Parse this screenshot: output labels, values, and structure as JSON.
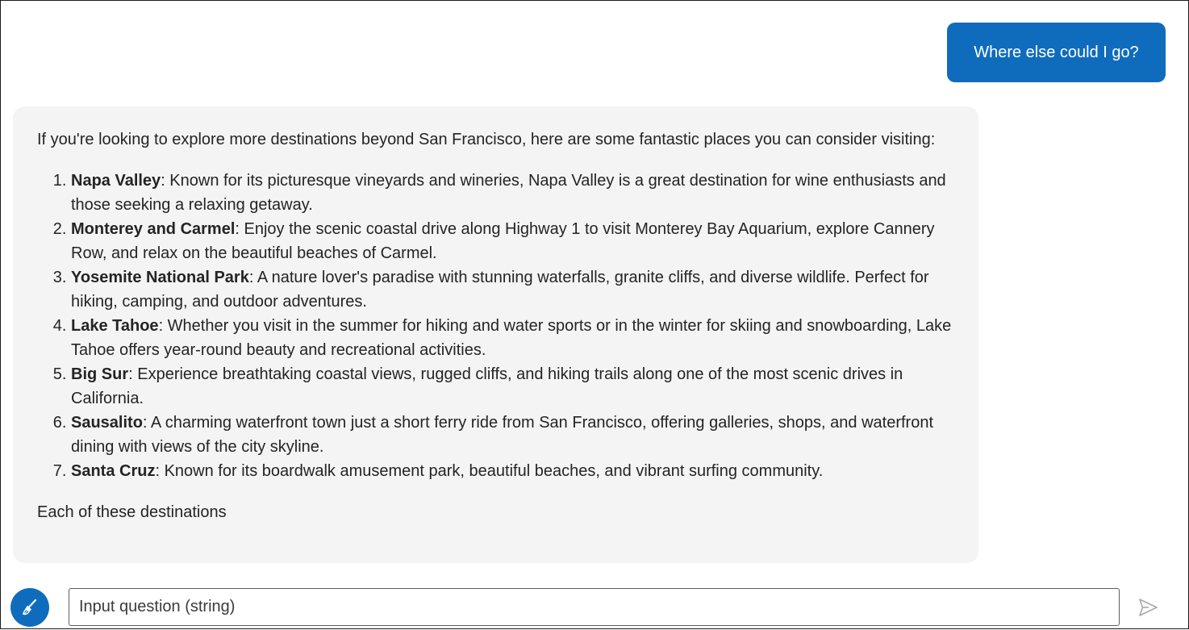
{
  "user_message": "Where else could I go?",
  "assistant": {
    "intro": "If you're looking to explore more destinations beyond San Francisco, here are some fantastic places you can consider visiting:",
    "items": [
      {
        "title": "Napa Valley",
        "text": ": Known for its picturesque vineyards and wineries, Napa Valley is a great destination for wine enthusiasts and those seeking a relaxing getaway."
      },
      {
        "title": "Monterey and Carmel",
        "text": ": Enjoy the scenic coastal drive along Highway 1 to visit Monterey Bay Aquarium, explore Cannery Row, and relax on the beautiful beaches of Carmel."
      },
      {
        "title": "Yosemite National Park",
        "text": ": A nature lover's paradise with stunning waterfalls, granite cliffs, and diverse wildlife. Perfect for hiking, camping, and outdoor adventures."
      },
      {
        "title": "Lake Tahoe",
        "text": ": Whether you visit in the summer for hiking and water sports or in the winter for skiing and snowboarding, Lake Tahoe offers year-round beauty and recreational activities."
      },
      {
        "title": "Big Sur",
        "text": ": Experience breathtaking coastal views, rugged cliffs, and hiking trails along one of the most scenic drives in California."
      },
      {
        "title": "Sausalito",
        "text": ": A charming waterfront town just a short ferry ride from San Francisco, offering galleries, shops, and waterfront dining with views of the city skyline."
      },
      {
        "title": "Santa Cruz",
        "text": ": Known for its boardwalk amusement park, beautiful beaches, and vibrant surfing community."
      }
    ],
    "outro": "Each of these destinations"
  },
  "input": {
    "placeholder": "Input question (string)",
    "value": ""
  },
  "icons": {
    "clear": "broom-icon",
    "send": "send-icon"
  },
  "colors": {
    "accent": "#0f6cbd",
    "bubble_bg": "#f4f4f4",
    "send_icon": "#b0b0b0"
  }
}
